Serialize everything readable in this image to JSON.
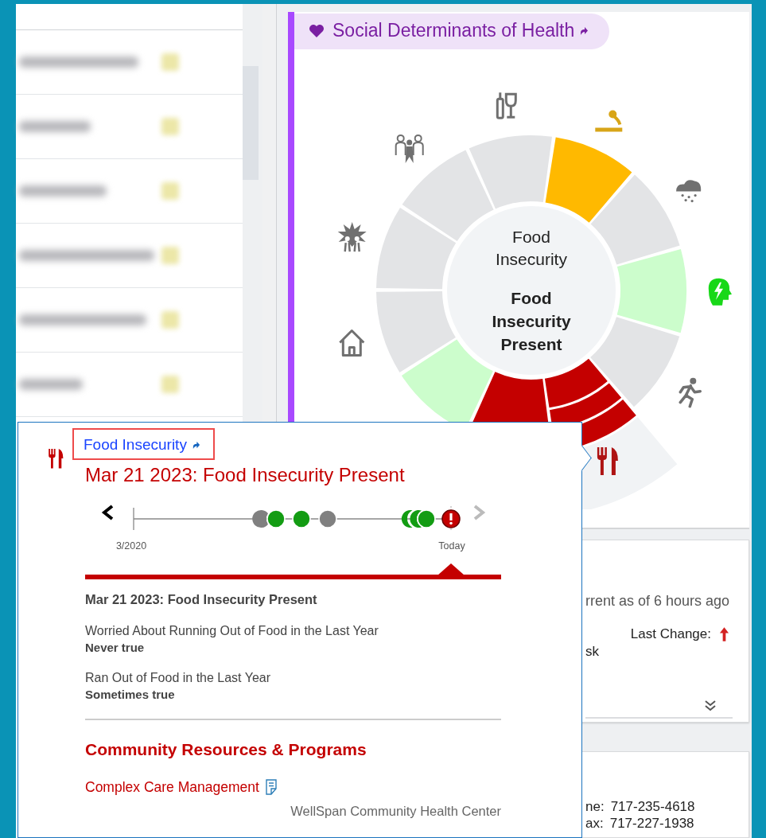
{
  "sdoh_panel": {
    "title": "Social Determinants of Health",
    "center": {
      "domain": "Food Insecurity",
      "status": "Food Insecurity Present"
    },
    "segments": [
      {
        "color": "#e3e4e6",
        "selected": false
      },
      {
        "color": "#ffb900",
        "selected": false
      },
      {
        "color": "#e3e4e6",
        "selected": false
      },
      {
        "color": "#ccfdcc",
        "selected": false
      },
      {
        "color": "#e3e4e6",
        "selected": false
      },
      {
        "color": "#c40000",
        "selected": true
      },
      {
        "color": "#c40000",
        "selected": false
      },
      {
        "color": "#ccfdcc",
        "selected": false
      },
      {
        "color": "#e3e4e6",
        "selected": false
      },
      {
        "color": "#e3e4e6",
        "selected": false
      },
      {
        "color": "#e3e4e6",
        "selected": false
      }
    ]
  },
  "popup": {
    "link": {
      "text": "Food Insecurity",
      "highlighted": true
    },
    "title": "Mar 21 2023: Food Insecurity Present",
    "timeline": {
      "prev": {
        "disabled": false
      },
      "next": {
        "disabled": true
      },
      "start_label": "3/2020",
      "end_label": "Today",
      "events": [
        {
          "kind": "unknown",
          "selected": false
        },
        {
          "kind": "negative",
          "selected": false
        },
        {
          "kind": "negative",
          "selected": false
        },
        {
          "kind": "unknown",
          "selected": false
        },
        {
          "kind": "negative",
          "selected": false
        },
        {
          "kind": "negative",
          "selected": false
        },
        {
          "kind": "negative",
          "selected": false
        },
        {
          "kind": "positive",
          "selected": true
        }
      ]
    },
    "entry": {
      "heading": "Mar 21 2023: Food Insecurity Present",
      "answers": [
        {
          "question": "Worried About Running Out of Food in the Last Year",
          "answer": "Never true"
        },
        {
          "question": "Ran Out of Food in the Last Year",
          "answer": "Sometimes true"
        }
      ]
    },
    "resources": {
      "heading": "Community Resources & Programs",
      "programs": [
        {
          "name": "Complex Care Management",
          "provider": "WellSpan Community Health Center"
        }
      ]
    }
  },
  "status_card": {
    "current_as_of": "rrent as of 6 hours ago",
    "last_change_label": "Last Change:",
    "risk_increased": true,
    "risk_text": "sk"
  },
  "contact_card": {
    "rows": [
      {
        "label": "ne:",
        "value": "717-235-4618"
      },
      {
        "label": "ax:",
        "value": "717-227-1938"
      }
    ]
  }
}
